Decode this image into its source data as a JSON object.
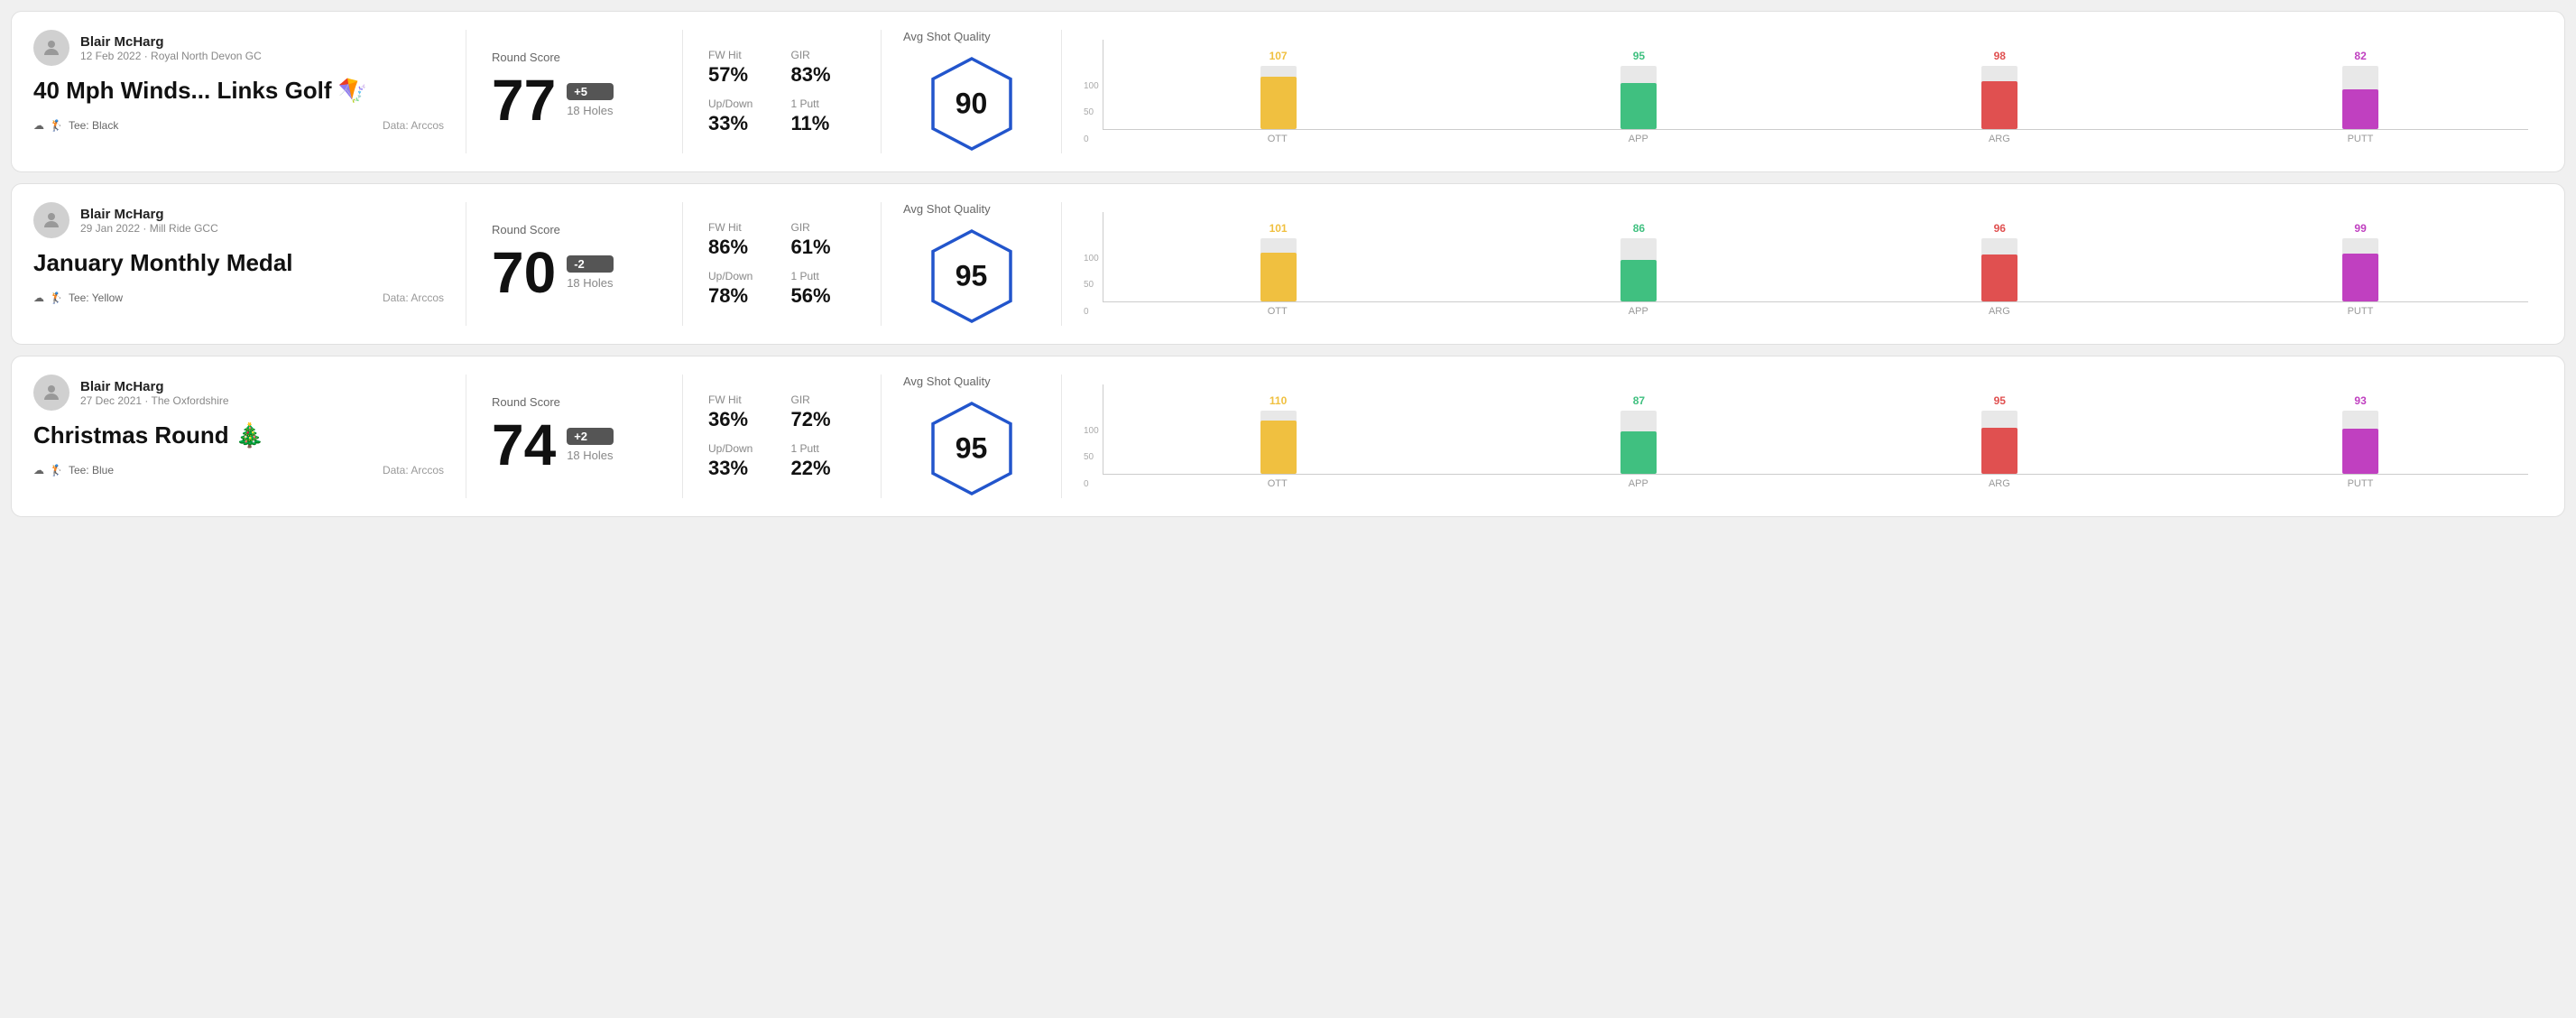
{
  "rounds": [
    {
      "id": "round1",
      "user": {
        "name": "Blair McHarg",
        "date_course": "12 Feb 2022 · Royal North Devon GC"
      },
      "title": "40 Mph Winds... Links Golf 🪁",
      "tee": "Black",
      "data_source": "Data: Arccos",
      "score": "77",
      "score_diff": "+5",
      "score_diff_type": "positive",
      "holes": "18 Holes",
      "fw_hit": "57%",
      "gir": "83%",
      "up_down": "33%",
      "one_putt": "11%",
      "avg_shot_quality": "90",
      "chart": {
        "bars": [
          {
            "label": "OTT",
            "value": 107,
            "color": "#f0c040",
            "max": 130
          },
          {
            "label": "APP",
            "value": 95,
            "color": "#40c080",
            "max": 130
          },
          {
            "label": "ARG",
            "value": 98,
            "color": "#e05050",
            "max": 130
          },
          {
            "label": "PUTT",
            "value": 82,
            "color": "#c040c0",
            "max": 130
          }
        ],
        "y_labels": [
          "100",
          "50",
          "0"
        ]
      }
    },
    {
      "id": "round2",
      "user": {
        "name": "Blair McHarg",
        "date_course": "29 Jan 2022 · Mill Ride GCC"
      },
      "title": "January Monthly Medal",
      "tee": "Yellow",
      "data_source": "Data: Arccos",
      "score": "70",
      "score_diff": "-2",
      "score_diff_type": "negative",
      "holes": "18 Holes",
      "fw_hit": "86%",
      "gir": "61%",
      "up_down": "78%",
      "one_putt": "56%",
      "avg_shot_quality": "95",
      "chart": {
        "bars": [
          {
            "label": "OTT",
            "value": 101,
            "color": "#f0c040",
            "max": 130
          },
          {
            "label": "APP",
            "value": 86,
            "color": "#40c080",
            "max": 130
          },
          {
            "label": "ARG",
            "value": 96,
            "color": "#e05050",
            "max": 130
          },
          {
            "label": "PUTT",
            "value": 99,
            "color": "#c040c0",
            "max": 130
          }
        ],
        "y_labels": [
          "100",
          "50",
          "0"
        ]
      }
    },
    {
      "id": "round3",
      "user": {
        "name": "Blair McHarg",
        "date_course": "27 Dec 2021 · The Oxfordshire"
      },
      "title": "Christmas Round 🎄",
      "tee": "Blue",
      "data_source": "Data: Arccos",
      "score": "74",
      "score_diff": "+2",
      "score_diff_type": "positive",
      "holes": "18 Holes",
      "fw_hit": "36%",
      "gir": "72%",
      "up_down": "33%",
      "one_putt": "22%",
      "avg_shot_quality": "95",
      "chart": {
        "bars": [
          {
            "label": "OTT",
            "value": 110,
            "color": "#f0c040",
            "max": 130
          },
          {
            "label": "APP",
            "value": 87,
            "color": "#40c080",
            "max": 130
          },
          {
            "label": "ARG",
            "value": 95,
            "color": "#e05050",
            "max": 130
          },
          {
            "label": "PUTT",
            "value": 93,
            "color": "#c040c0",
            "max": 130
          }
        ],
        "y_labels": [
          "100",
          "50",
          "0"
        ]
      }
    }
  ],
  "labels": {
    "round_score": "Round Score",
    "fw_hit": "FW Hit",
    "gir": "GIR",
    "up_down": "Up/Down",
    "one_putt": "1 Putt",
    "avg_shot_quality": "Avg Shot Quality",
    "tee_prefix": "Tee:",
    "data_arccos": "Data: Arccos"
  }
}
